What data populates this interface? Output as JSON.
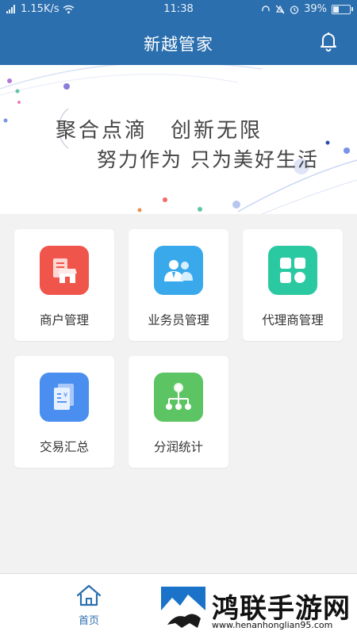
{
  "status_bar": {
    "network_speed": "1.15K/s",
    "time": "11:38",
    "battery": "39%",
    "battery_level": 0.39
  },
  "header": {
    "title": "新越管家"
  },
  "banner": {
    "line1": "聚合点滴　创新无限",
    "line2": "努力作为 只为美好生活"
  },
  "menu": {
    "items": [
      {
        "label": "商户管理",
        "icon": "shop-icon",
        "color": "#f0554b"
      },
      {
        "label": "业务员管理",
        "icon": "staff-icon",
        "color": "#3aa9ec"
      },
      {
        "label": "代理商管理",
        "icon": "grid-icon",
        "color": "#2bc9a1"
      },
      {
        "label": "交易汇总",
        "icon": "receipt-icon",
        "color": "#4a8ff0"
      },
      {
        "label": "分润统计",
        "icon": "tree-icon",
        "color": "#5cc462"
      }
    ]
  },
  "tabbar": {
    "home_label": "首页",
    "accent": "#2b6fae"
  },
  "watermark": {
    "title": "鸿联手游网",
    "url": "www.henanhonglian95.com"
  }
}
